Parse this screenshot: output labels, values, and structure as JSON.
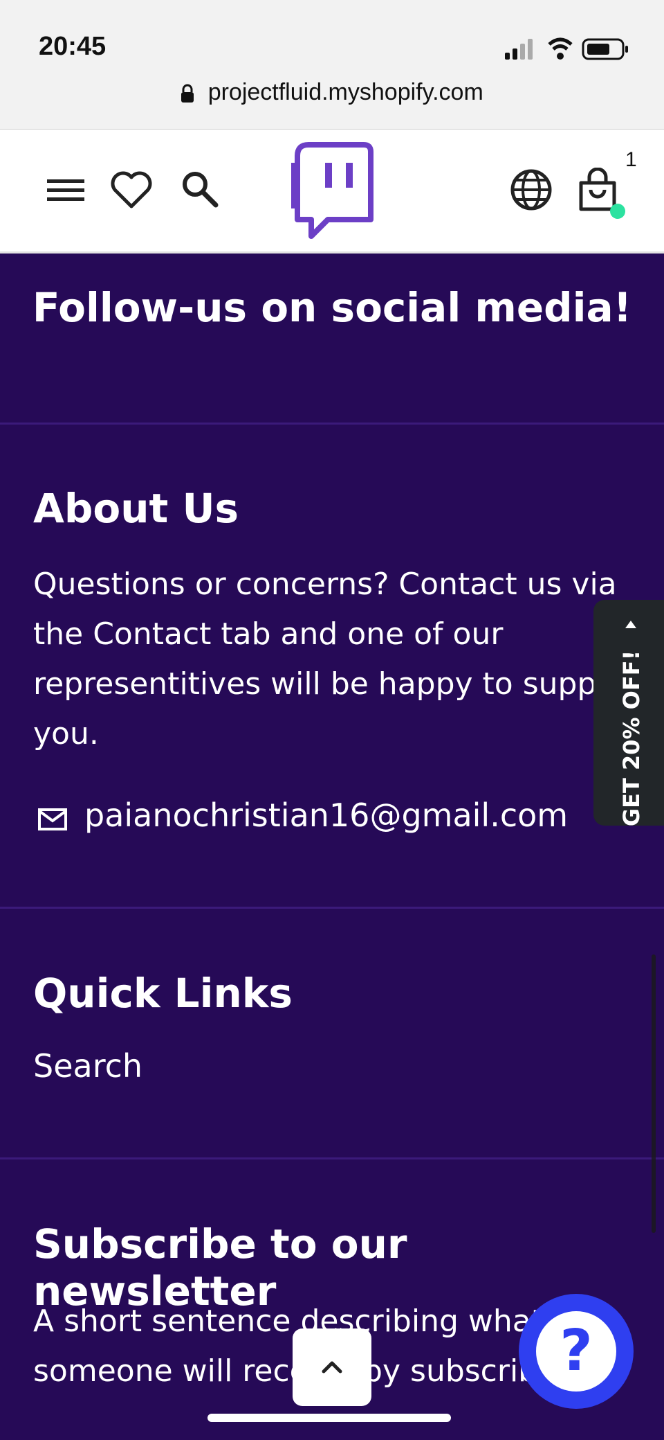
{
  "status_bar": {
    "time": "20:45"
  },
  "browser": {
    "url": "projectfluid.myshopify.com"
  },
  "header": {
    "cart_count": "1"
  },
  "follow": {
    "title": "Follow-us on social media!"
  },
  "about": {
    "title": "About Us",
    "text": "Questions or concerns? Contact us via the Contact tab and one of our representitives will be happy to support you.",
    "email": "paianochristian16@gmail.com"
  },
  "quick_links": {
    "title": "Quick Links",
    "items": [
      "Search"
    ]
  },
  "newsletter": {
    "title": "Subscribe to our newsletter",
    "text": "A short sentence describing what someone will receive by subscribing"
  },
  "promo": {
    "label": "GET 20% OFF!"
  },
  "help": {
    "label": "?"
  },
  "colors": {
    "background": "#260a57",
    "brand": "#6c3fc6",
    "help": "#2f3ff0",
    "cart_dot": "#2ce2a0"
  }
}
